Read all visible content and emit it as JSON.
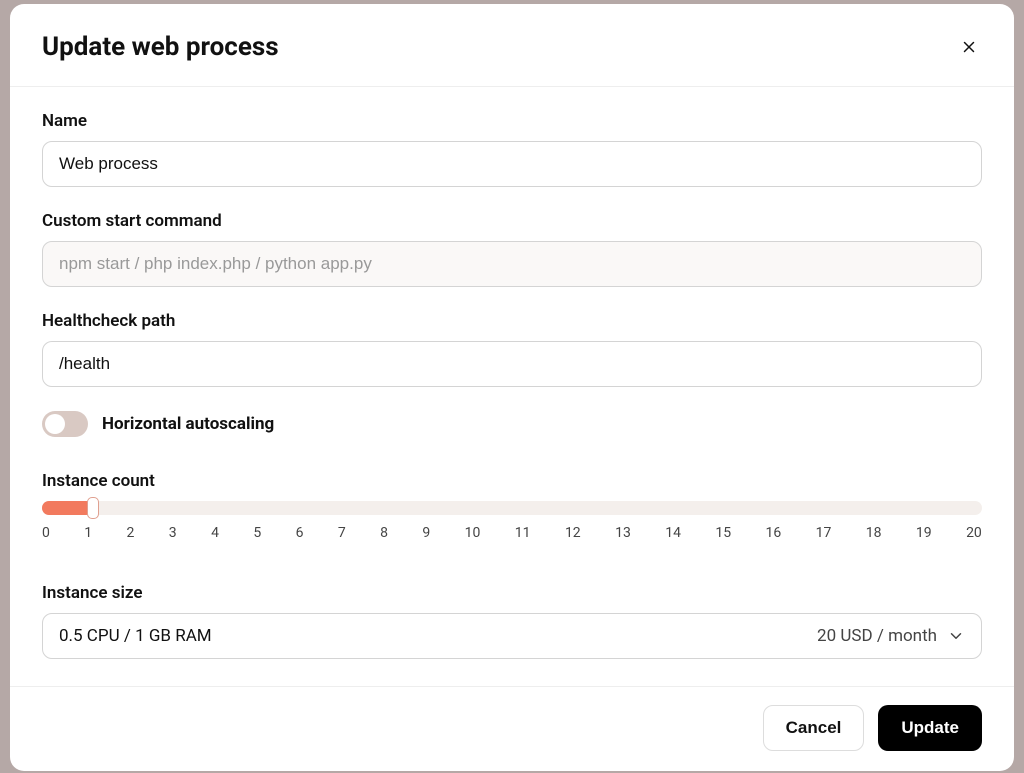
{
  "header": {
    "title": "Update web process"
  },
  "fields": {
    "name": {
      "label": "Name",
      "value": "Web process"
    },
    "custom_start": {
      "label": "Custom start command",
      "value": "",
      "placeholder": "npm start / php index.php / python app.py"
    },
    "healthcheck": {
      "label": "Healthcheck path",
      "value": "/health"
    },
    "autoscale": {
      "label": "Horizontal autoscaling",
      "on": false
    },
    "instance_count": {
      "label": "Instance count",
      "value": 1,
      "min": 0,
      "max": 20,
      "ticks": [
        "0",
        "1",
        "2",
        "3",
        "4",
        "5",
        "6",
        "7",
        "8",
        "9",
        "10",
        "11",
        "12",
        "13",
        "14",
        "15",
        "16",
        "17",
        "18",
        "19",
        "20"
      ]
    },
    "instance_size": {
      "label": "Instance size",
      "selected": "0.5 CPU / 1 GB RAM",
      "price": "20 USD / month"
    }
  },
  "footer": {
    "cancel": "Cancel",
    "update": "Update"
  }
}
